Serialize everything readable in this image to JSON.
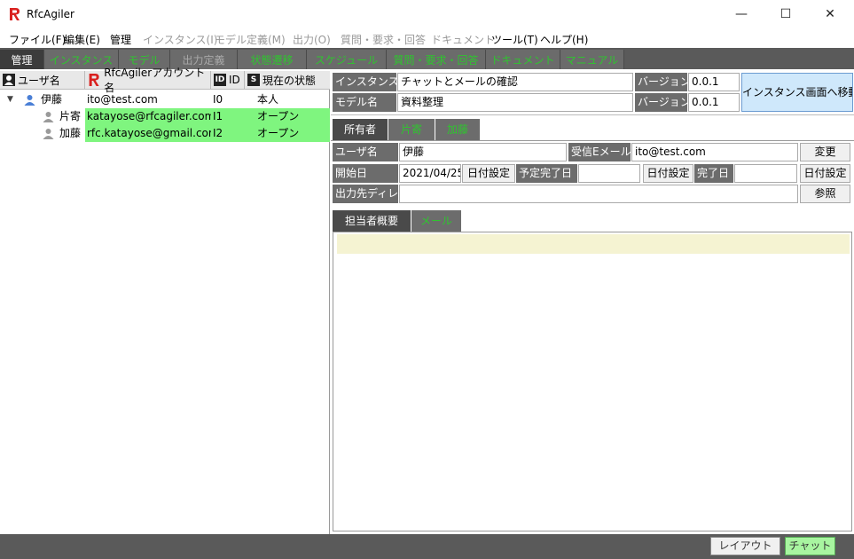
{
  "window": {
    "title": "RfcAgiler",
    "minimize": "—",
    "maximize": "☐",
    "close": "✕"
  },
  "menu": [
    {
      "label": "ファイル(F)",
      "enabled": true
    },
    {
      "label": "編集(E)",
      "enabled": true
    },
    {
      "label": "管理",
      "enabled": true
    },
    {
      "label": "インスタンス(I)",
      "enabled": false
    },
    {
      "label": "モデル定義(M)",
      "enabled": false
    },
    {
      "label": "出力(O)",
      "enabled": false
    },
    {
      "label": "質問・要求・回答",
      "enabled": false
    },
    {
      "label": "ドキュメント",
      "enabled": false
    },
    {
      "label": "ツール(T)",
      "enabled": true
    },
    {
      "label": "ヘルプ(H)",
      "enabled": true
    }
  ],
  "tabs": [
    {
      "label": "管理",
      "state": "active"
    },
    {
      "label": "インスタンス",
      "state": "green"
    },
    {
      "label": "モデル",
      "state": "green"
    },
    {
      "label": "出力定義",
      "state": "gray"
    },
    {
      "label": "状態遷移",
      "state": "green"
    },
    {
      "label": "スケジュール",
      "state": "green"
    },
    {
      "label": "質問・要求・回答",
      "state": "green"
    },
    {
      "label": "ドキュメント",
      "state": "green"
    },
    {
      "label": "マニュアル",
      "state": "green"
    }
  ],
  "user_table": {
    "columns": {
      "user": "ユーザ名",
      "account": "RfcAgilerアカウント名",
      "id": "ID",
      "status": "現在の状態"
    },
    "col_icons": {
      "id": "ID",
      "status": "S"
    },
    "rows": [
      {
        "name": "伊藤",
        "account": "ito@test.com",
        "id": "I0",
        "status": "本人",
        "level": 0,
        "expanded": true,
        "highlight": false
      },
      {
        "name": "片寄",
        "account": "katayose@rfcagiler.com",
        "id": "I1",
        "status": "オープン",
        "level": 1,
        "highlight": true
      },
      {
        "name": "加藤",
        "account": "rfc.katayose@gmail.com",
        "id": "I2",
        "status": "オープン",
        "level": 1,
        "highlight": true
      }
    ]
  },
  "instance": {
    "name_label": "インスタンス名",
    "name_value": "チャットとメールの確認",
    "model_label": "モデル名",
    "model_value": "資料整理",
    "version_label": "バージョン",
    "version_value": "0.0.1",
    "version_label2": "バージョン",
    "version_value2": "0.0.1",
    "goto_button": "インスタンス画面へ移動"
  },
  "owner_tabs": [
    {
      "label": "所有者",
      "state": "active"
    },
    {
      "label": "片寄",
      "state": "green"
    },
    {
      "label": "加藤",
      "state": "green"
    }
  ],
  "owner": {
    "user_label": "ユーザ名",
    "user_value": "伊藤",
    "email_label": "受信Eメール",
    "email_value": "ito@test.com",
    "change_button": "変更",
    "start_label": "開始日",
    "start_value": "2021/04/25",
    "start_button": "日付設定",
    "planned_label": "予定完了日",
    "planned_value": "",
    "planned_button": "日付設定",
    "done_label": "完了日",
    "done_value": "",
    "done_button": "日付設定",
    "output_label": "出力先ディレ",
    "output_value": "",
    "browse_button": "参照"
  },
  "detail_tabs": [
    {
      "label": "担当者概要",
      "state": "active"
    },
    {
      "label": "メール",
      "state": "green"
    }
  ],
  "status_bar": {
    "layout_button": "レイアウト",
    "chat_button": "チャット"
  },
  "colors": {
    "accent_green": "#2fc42f",
    "highlight_green": "#7ff57f",
    "dark_gray": "#5a5a5a",
    "goto_button_bg": "#cfe8fb",
    "note_bg": "#f5f3d2"
  }
}
